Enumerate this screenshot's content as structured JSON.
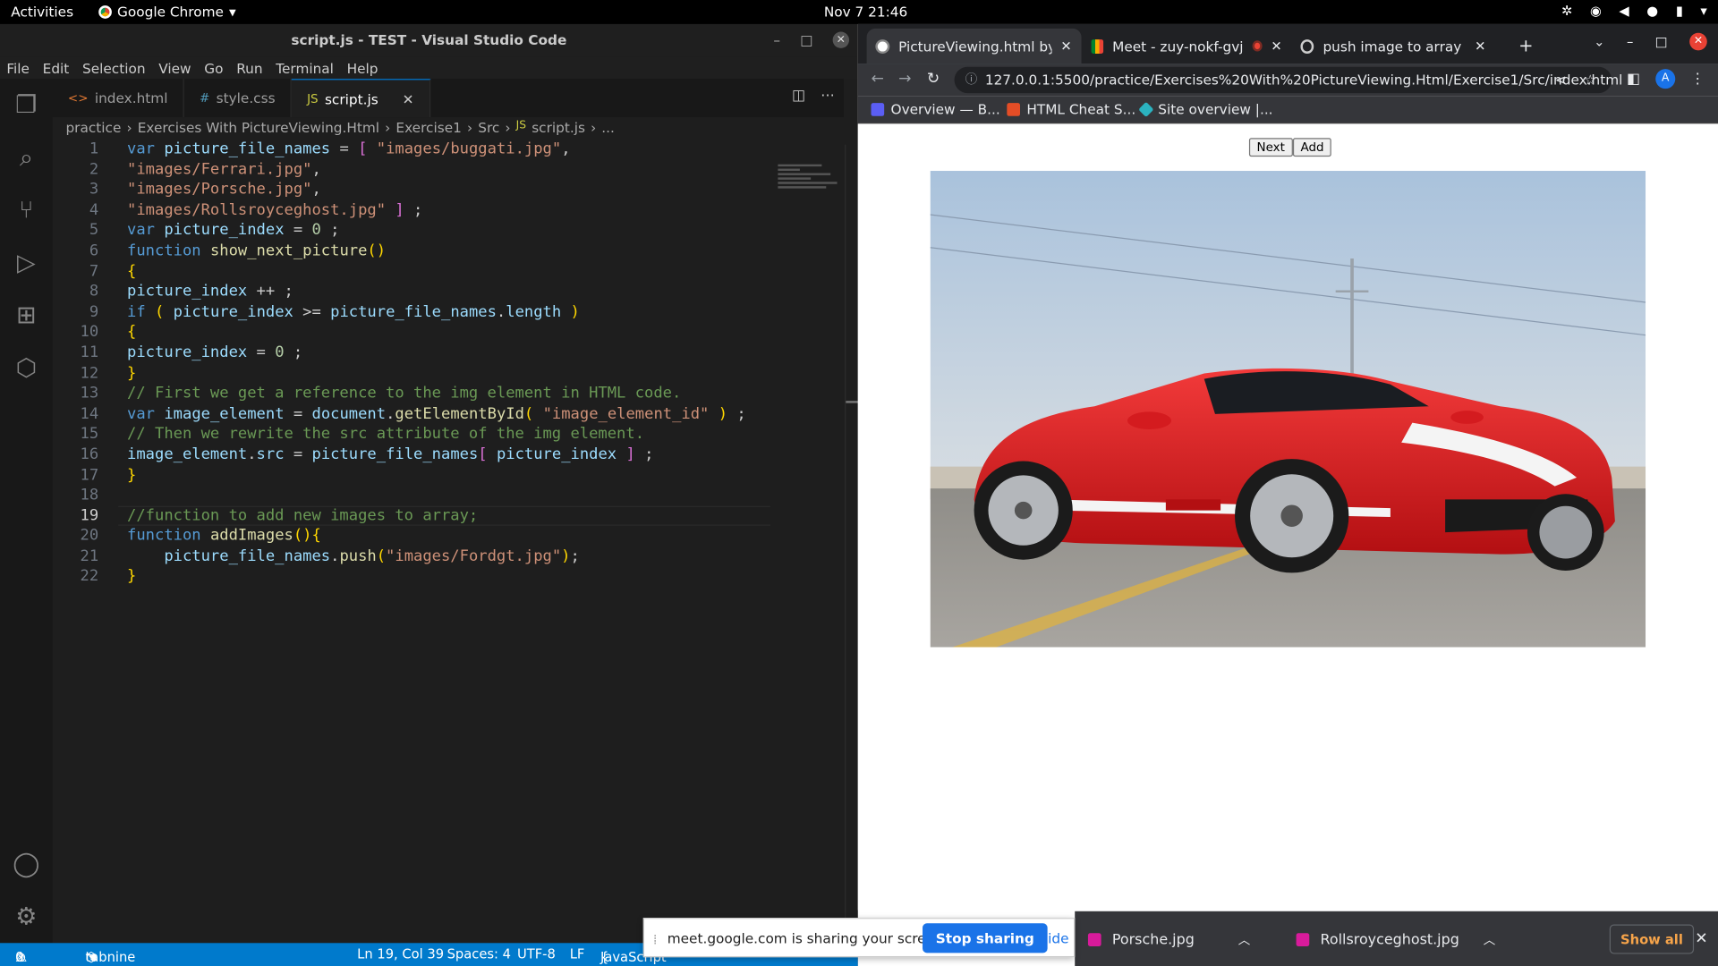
{
  "topbar": {
    "activities": "Activities",
    "app": "Google Chrome",
    "clock": "Nov 7  21:46"
  },
  "vscode": {
    "title": "script.js - TEST - Visual Studio Code",
    "menu": [
      "File",
      "Edit",
      "Selection",
      "View",
      "Go",
      "Run",
      "Terminal",
      "Help"
    ],
    "tabs": [
      {
        "label": "index.html",
        "icon": "<>"
      },
      {
        "label": "style.css",
        "icon": "#"
      },
      {
        "label": "script.js",
        "icon": "JS"
      }
    ],
    "breadcrumb": [
      "practice",
      "Exercises With PictureViewing.Html",
      "Exercise1",
      "Src",
      "script.js",
      "..."
    ],
    "code_lines": [
      "var picture_file_names = [ \"images/buggati.jpg\",",
      "\"images/Ferrari.jpg\",",
      "\"images/Porsche.jpg\",",
      "\"images/Rollsroyceghost.jpg\" ] ;",
      "var picture_index = 0 ;",
      "function show_next_picture()",
      "{",
      "picture_index ++ ;",
      "if ( picture_index >= picture_file_names.length )",
      "{",
      "picture_index = 0 ;",
      "}",
      "// First we get a reference to the img element in HTML code.",
      "var image_element = document.getElementById( \"image_element_id\" ) ;",
      "// Then we rewrite the src attribute of the img element.",
      "image_element.src = picture_file_names[ picture_index ] ;",
      "}",
      "",
      "//function to add new images to array;",
      "function addImages(){",
      "    picture_file_names.push(\"images/Fordgt.jpg\");",
      "}"
    ],
    "status": {
      "errors": "0",
      "warnings": "0",
      "tabnine": "tabnine starter",
      "position": "Ln 19, Col 39",
      "spaces": "Spaces: 4",
      "encoding": "UTF-8",
      "eol": "LF",
      "language": "JavaScript"
    }
  },
  "chrome": {
    "tabs": [
      {
        "label": "PictureViewing.html by K"
      },
      {
        "label": "Meet - zuy-nokf-gvj"
      },
      {
        "label": "push image to array usin"
      }
    ],
    "url": "127.0.0.1:5500/practice/Exercises%20With%20PictureViewing.Html/Exercise1/Src/index.html",
    "avatar": "A",
    "bookmarks": [
      "Overview — B...",
      "HTML Cheat S...",
      "Site overview |..."
    ],
    "page": {
      "next_button": "Next",
      "add_button": "Add"
    },
    "share": {
      "message": "meet.google.com is sharing your screen.",
      "stop": "Stop sharing",
      "hide": "Hide"
    },
    "downloads": [
      "Porsche.jpg",
      "Rollsroyceghost.jpg"
    ],
    "show_all": "Show all"
  }
}
